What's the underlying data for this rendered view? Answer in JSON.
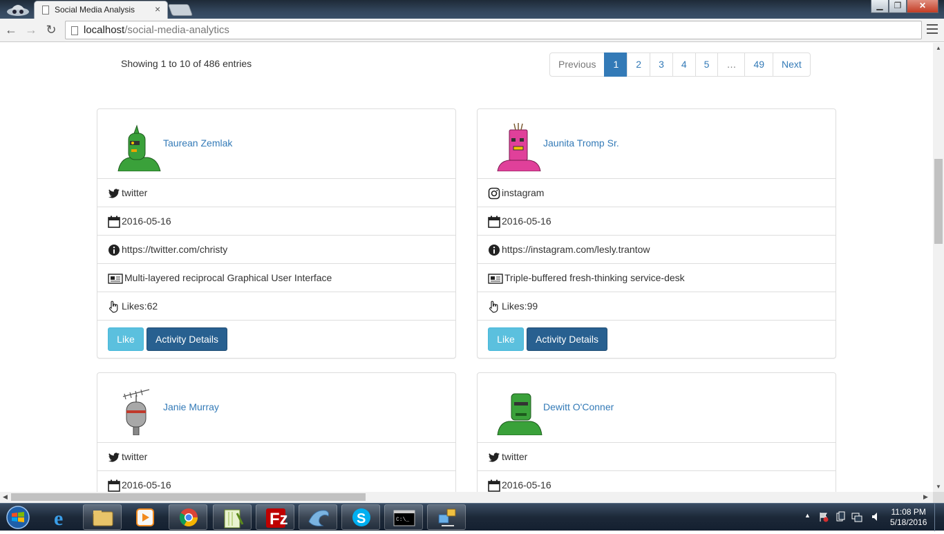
{
  "browser": {
    "tab_title": "Social Media Analysis",
    "tab_close": "×",
    "url_host": "localhost",
    "url_path": "/social-media-analytics",
    "nav": {
      "back": "←",
      "forward": "→",
      "reload": "↻"
    },
    "window": {
      "minimize": "▁",
      "maximize": "❐",
      "close": "✕"
    }
  },
  "listing": {
    "entries_text": "Showing 1 to 10 of 486 entries",
    "pagination": [
      "Previous",
      "1",
      "2",
      "3",
      "4",
      "5",
      "…",
      "49",
      "Next"
    ],
    "active_page": "1"
  },
  "cards": [
    {
      "name": "Taurean Zemlak",
      "avatar_color": "#3aa13a",
      "network": "twitter",
      "date": "2016-05-16",
      "profile_url": "https://twitter.com/christy",
      "description": "Multi-layered reciprocal Graphical User Interface",
      "likes": "Likes:62",
      "like_label": "Like",
      "details_label": "Activity Details"
    },
    {
      "name": "Jaunita Tromp Sr.",
      "avatar_color": "#e0409a",
      "network": "instagram",
      "date": "2016-05-16",
      "profile_url": "https://instagram.com/lesly.trantow",
      "description": "Triple-buffered fresh-thinking service-desk",
      "likes": "Likes:99",
      "like_label": "Like",
      "details_label": "Activity Details"
    },
    {
      "name": "Janie Murray",
      "avatar_color": "#a8a8a8",
      "network": "twitter",
      "date": "2016-05-16"
    },
    {
      "name": "Dewitt O'Conner",
      "avatar_color": "#3aa13a",
      "network": "twitter",
      "date": "2016-05-16"
    }
  ],
  "taskbar": {
    "apps": [
      "internet-explorer",
      "file-explorer",
      "media-player",
      "chrome",
      "notepad-plus-plus",
      "filezilla",
      "mysql-workbench",
      "skype",
      "command-prompt",
      "network-tool"
    ],
    "time": "11:08 PM",
    "date": "5/18/2016"
  },
  "colors": {
    "link": "#337ab7",
    "like_button": "#5bc0de",
    "details_button": "#286090",
    "border": "#dddddd"
  }
}
